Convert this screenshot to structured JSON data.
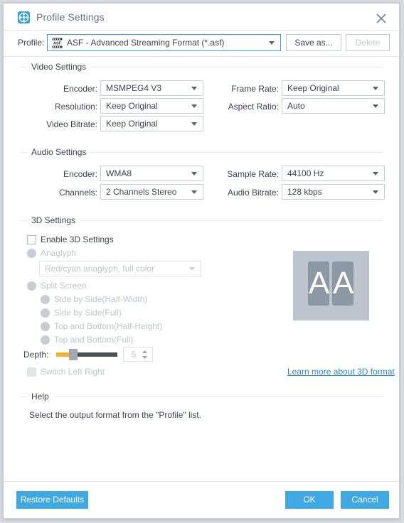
{
  "window": {
    "title": "Profile Settings",
    "icon": "app-reel-icon",
    "close_icon": "close-icon"
  },
  "profile": {
    "label": "Profile:",
    "value": "ASF - Advanced Streaming Format (*.asf)",
    "file_icon": "asf-file-icon",
    "save_as_label": "Save as...",
    "delete_label": "Delete"
  },
  "video": {
    "group_title": "Video Settings",
    "fields": [
      {
        "label": "Encoder:",
        "value": "MSMPEG4 V3"
      },
      {
        "label": "Resolution:",
        "value": "Keep Original"
      },
      {
        "label": "Video Bitrate:",
        "value": "Keep Original"
      },
      {
        "label": "Frame Rate:",
        "value": "Keep Original"
      },
      {
        "label": "Aspect Ratio:",
        "value": "Auto"
      }
    ]
  },
  "audio": {
    "group_title": "Audio Settings",
    "fields": [
      {
        "label": "Encoder:",
        "value": "WMA8"
      },
      {
        "label": "Channels:",
        "value": "2 Channels Stereo"
      },
      {
        "label": "Sample Rate:",
        "value": "44100 Hz"
      },
      {
        "label": "Audio Bitrate:",
        "value": "128 kbps"
      }
    ]
  },
  "three_d": {
    "group_title": "3D Settings",
    "enable_label": "Enable 3D Settings",
    "enable_checked": false,
    "anaglyph_label": "Anaglyph",
    "anaglyph_value": "Red/cyan anaglyph, full color",
    "split_screen_label": "Split Screen",
    "split_options": [
      "Side by Side(Half-Width)",
      "Side by Side(Full)",
      "Top and Bottom(Half-Height)",
      "Top and Bottom(Full)"
    ],
    "depth_label": "Depth:",
    "depth_value": "5",
    "switch_label": "Switch Left Right",
    "link_label": "Learn more about 3D format",
    "preview_left_glyph": "A",
    "preview_right_glyph": "A"
  },
  "help": {
    "group_title": "Help",
    "text": "Select the output format from the \"Profile\" list."
  },
  "footer": {
    "restore_label": "Restore Defaults",
    "ok_label": "OK",
    "cancel_label": "Cancel"
  },
  "colors": {
    "accent": "#3fa9e5",
    "link": "#2288d8",
    "slider_fill": "#f5b521",
    "preview_bg": "#bcc5ce",
    "preview_panel": "#8c99a4"
  }
}
